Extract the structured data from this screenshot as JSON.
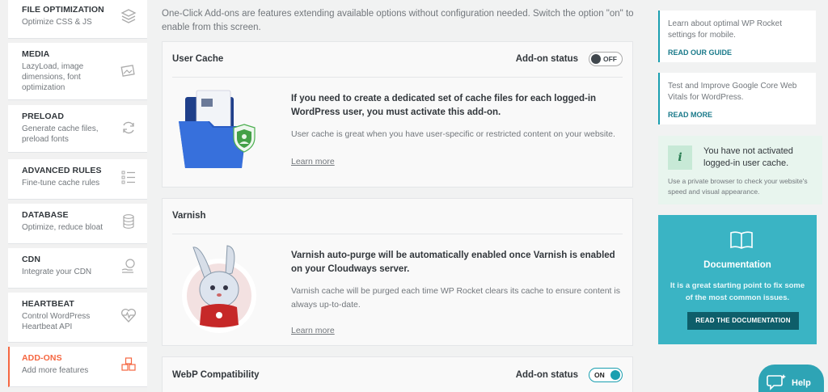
{
  "sidebar": {
    "items": [
      {
        "title": "FILE OPTIMIZATION",
        "desc": "Optimize CSS & JS",
        "icon": "layers-icon"
      },
      {
        "title": "MEDIA",
        "desc": "LazyLoad, image dimensions, font optimization",
        "icon": "images-icon"
      },
      {
        "title": "PRELOAD",
        "desc": "Generate cache files, preload fonts",
        "icon": "refresh-icon"
      },
      {
        "title": "ADVANCED RULES",
        "desc": "Fine-tune cache rules",
        "icon": "list-icon"
      },
      {
        "title": "DATABASE",
        "desc": "Optimize, reduce bloat",
        "icon": "database-icon"
      },
      {
        "title": "CDN",
        "desc": "Integrate your CDN",
        "icon": "cdn-hand-icon"
      },
      {
        "title": "HEARTBEAT",
        "desc": "Control WordPress Heartbeat API",
        "icon": "heartbeat-icon"
      },
      {
        "title": "ADD-ONS",
        "desc": "Add more features",
        "icon": "cubes-icon",
        "active": true
      }
    ]
  },
  "main": {
    "intro": "One-Click Add-ons are features extending available options without configuration needed. Switch the option \"on\" to enable from this screen.",
    "addons": [
      {
        "title": "User Cache",
        "status_label": "Add-on status",
        "toggle": "OFF",
        "lead": "If you need to create a dedicated set of cache files for each logged-in WordPress user, you must activate this add-on.",
        "desc": "User cache is great when you have user-specific or restricted content on your website.",
        "learn": "Learn more"
      },
      {
        "title": "Varnish",
        "lead": "Varnish auto-purge will be automatically enabled once Varnish is enabled on your Cloudways server.",
        "desc": "Varnish cache will be purged each time WP Rocket clears its cache to ensure content is always up-to-date.",
        "learn": "Learn more"
      },
      {
        "title": "WebP Compatibility",
        "status_label": "Add-on status",
        "toggle": "ON"
      }
    ]
  },
  "right": {
    "tips": [
      {
        "text": "Learn about optimal WP Rocket settings for mobile.",
        "link": "READ OUR GUIDE"
      },
      {
        "text": "Test and Improve Google Core Web Vitals for WordPress.",
        "link": "READ MORE"
      }
    ],
    "notice": {
      "icon_letter": "i",
      "title": "You have not activated logged-in user cache.",
      "desc": "Use a private browser to check your website's speed and visual appearance."
    },
    "documentation": {
      "title": "Documentation",
      "desc": "It is a great starting point to fix some of the most common issues.",
      "button": "READ THE DOCUMENTATION"
    }
  },
  "help": {
    "label": "Help"
  },
  "colors": {
    "accent": "#f56640",
    "teal": "#3ab4c4",
    "dark_teal": "#0e5e6a",
    "toggle_on": "#1a9fb0"
  }
}
